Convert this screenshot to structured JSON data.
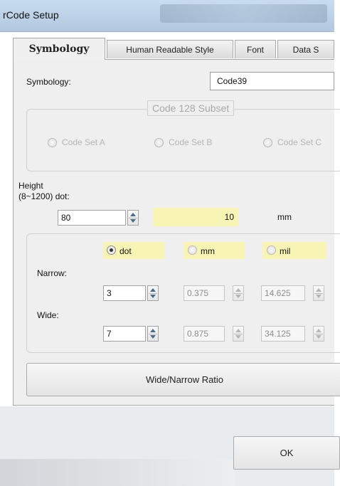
{
  "window": {
    "title": "rCode Setup"
  },
  "tabs": [
    {
      "label": "Symbology",
      "active": true
    },
    {
      "label": "Human Readable Style",
      "active": false
    },
    {
      "label": "Font",
      "active": false
    },
    {
      "label": "Data S",
      "active": false
    }
  ],
  "symbology": {
    "label": "Symbology:",
    "value": "Code39"
  },
  "code128": {
    "title": "Code 128 Subset",
    "options": [
      "Code Set A",
      "Code Set B",
      "Code Set C"
    ]
  },
  "height": {
    "label_line1": "Height",
    "label_line2": "(8~1200) dot:",
    "dot_value": "80",
    "mm_value": "10",
    "mm_unit": "mm"
  },
  "units": {
    "options": [
      {
        "label": "dot",
        "selected": true
      },
      {
        "label": "mm",
        "selected": false
      },
      {
        "label": "mil",
        "selected": false
      }
    ]
  },
  "narrow": {
    "label": "Narrow:",
    "dot": "3",
    "mm": "0.375",
    "mil": "14.625"
  },
  "wide": {
    "label": "Wide:",
    "dot": "7",
    "mm": "0.875",
    "mil": "34.125"
  },
  "ratio_button": "Wide/Narrow Ratio",
  "ok_button": "OK",
  "colors": {
    "highlight": "#f8f4b3",
    "panel": "#efefef"
  }
}
